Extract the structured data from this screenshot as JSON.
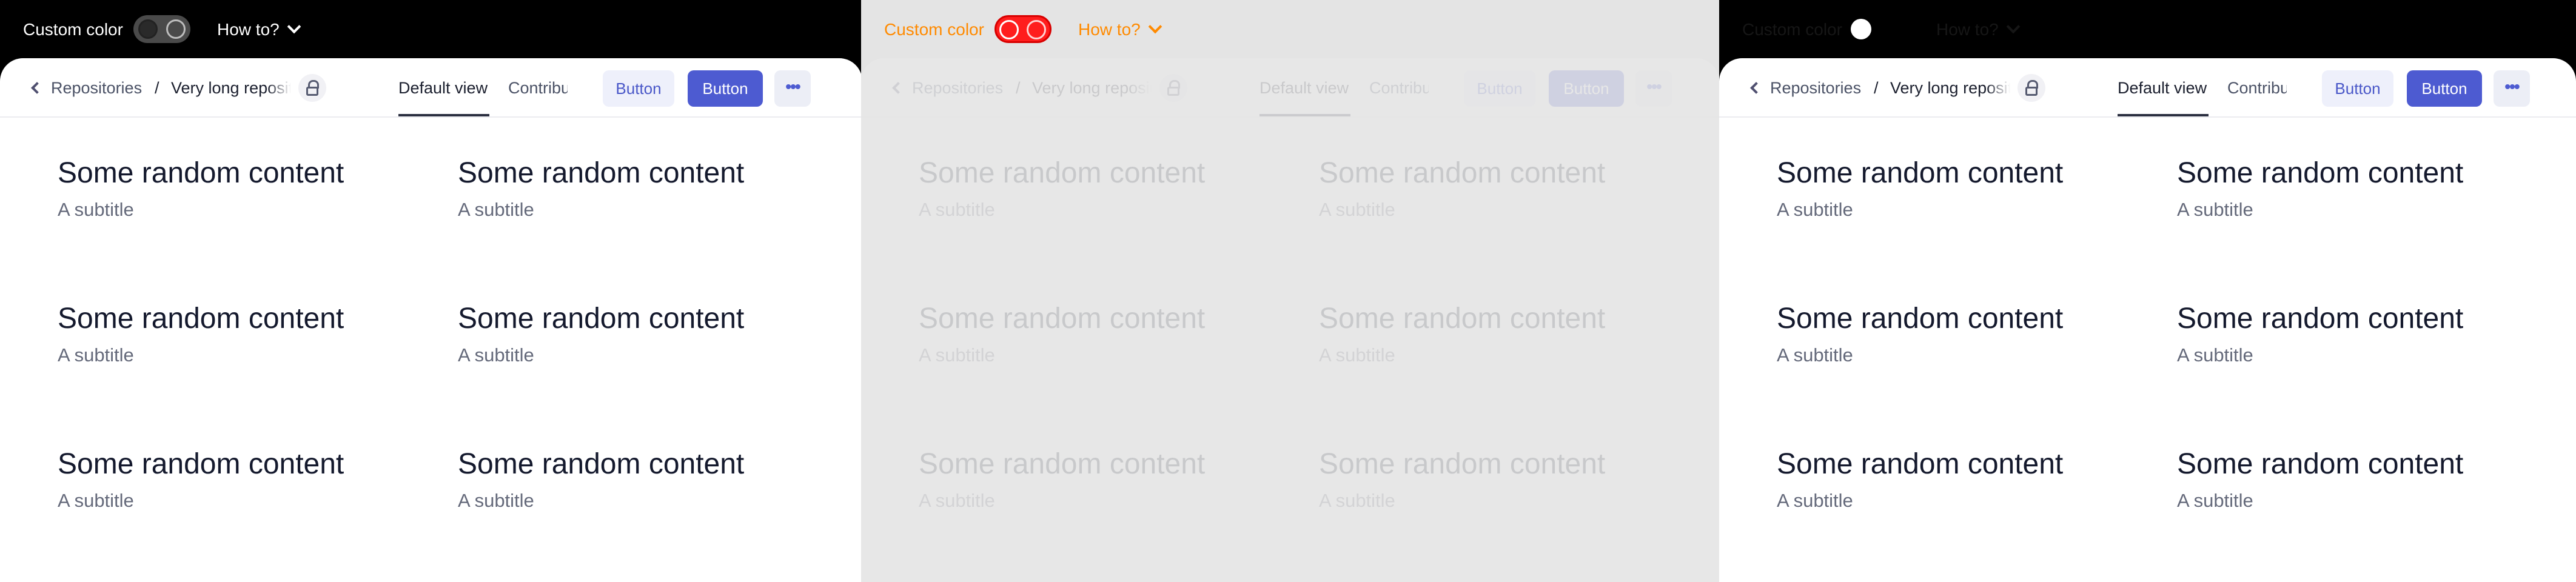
{
  "panels": [
    {
      "variant": "dark",
      "custom_color_label": "Custom color",
      "toggle_state": "off",
      "howto_label": "How to?",
      "breadcrumb": {
        "back_icon": "chevron-left-icon",
        "root": "Repositories",
        "separator": "/",
        "current": "Very long repository"
      },
      "lock_icon": "lock-icon",
      "tabs": [
        {
          "label": "Default view",
          "active": true
        },
        {
          "label": "Contributors",
          "active": false
        }
      ],
      "buttons": {
        "secondary": "Button",
        "primary": "Button",
        "more_icon": "more-horizontal-icon"
      },
      "items": [
        {
          "title": "Some random content",
          "subtitle": "A subtitle"
        },
        {
          "title": "Some random content",
          "subtitle": "A subtitle"
        },
        {
          "title": "Some random content",
          "subtitle": "A subtitle"
        },
        {
          "title": "Some random content",
          "subtitle": "A subtitle"
        },
        {
          "title": "Some random content",
          "subtitle": "A subtitle"
        },
        {
          "title": "Some random content",
          "subtitle": "A subtitle"
        }
      ]
    },
    {
      "variant": "custom",
      "custom_color_label": "Custom color",
      "toggle_state": "on",
      "howto_label": "How to?",
      "breadcrumb": {
        "back_icon": "chevron-left-icon",
        "root": "Repositories",
        "separator": "/",
        "current": "Very long repository"
      },
      "lock_icon": "lock-icon",
      "tabs": [
        {
          "label": "Default view",
          "active": true
        },
        {
          "label": "Contributors",
          "active": false
        }
      ],
      "buttons": {
        "secondary": "Button",
        "primary": "Button",
        "more_icon": "more-horizontal-icon"
      },
      "items": [
        {
          "title": "Some random content",
          "subtitle": "A subtitle"
        },
        {
          "title": "Some random content",
          "subtitle": "A subtitle"
        },
        {
          "title": "Some random content",
          "subtitle": "A subtitle"
        },
        {
          "title": "Some random content",
          "subtitle": "A subtitle"
        },
        {
          "title": "Some random content",
          "subtitle": "A subtitle"
        },
        {
          "title": "Some random content",
          "subtitle": "A subtitle"
        }
      ]
    },
    {
      "variant": "light",
      "custom_color_label": "Custom color",
      "toggle_state": "off",
      "howto_label": "How to?",
      "breadcrumb": {
        "back_icon": "chevron-left-icon",
        "root": "Repositories",
        "separator": "/",
        "current": "Very long repository"
      },
      "lock_icon": "lock-icon",
      "tabs": [
        {
          "label": "Default view",
          "active": true
        },
        {
          "label": "Contributors",
          "active": false
        }
      ],
      "buttons": {
        "secondary": "Button",
        "primary": "Button",
        "more_icon": "more-horizontal-icon"
      },
      "items": [
        {
          "title": "Some random content",
          "subtitle": "A subtitle"
        },
        {
          "title": "Some random content",
          "subtitle": "A subtitle"
        },
        {
          "title": "Some random content",
          "subtitle": "A subtitle"
        },
        {
          "title": "Some random content",
          "subtitle": "A subtitle"
        },
        {
          "title": "Some random content",
          "subtitle": "A subtitle"
        },
        {
          "title": "Some random content",
          "subtitle": "A subtitle"
        }
      ]
    }
  ],
  "colors": {
    "accent": "#4d5bd1",
    "custom_label": "#ff8a00",
    "custom_toggle": "#ff1d1d",
    "dark_bar": "#000000"
  }
}
